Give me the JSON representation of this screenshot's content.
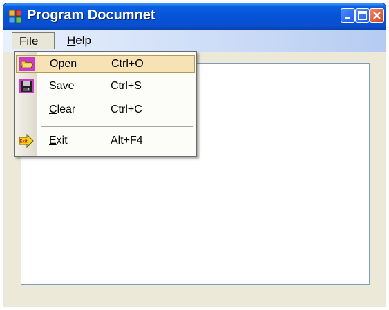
{
  "window": {
    "title": "Program Documnet"
  },
  "menubar": {
    "items": [
      {
        "label_ul": "F",
        "label_rest": "ile"
      },
      {
        "label_ul": "H",
        "label_rest": "elp"
      }
    ]
  },
  "file_menu": {
    "items": [
      {
        "ul": "O",
        "rest": "pen",
        "shortcut": "Ctrl+O",
        "icon": "open-folder-icon"
      },
      {
        "ul": "S",
        "rest": "ave",
        "shortcut": "Ctrl+S",
        "icon": "floppy-disk-icon"
      },
      {
        "ul": "C",
        "rest": "lear",
        "shortcut": "Ctrl+C",
        "icon": ""
      },
      {
        "ul": "E",
        "rest": "xit",
        "shortcut": "Alt+F4",
        "icon": "exit-arrow-icon"
      }
    ],
    "exit_icon_text": "Exit"
  },
  "colors": {
    "titlebar": "#0553d6",
    "highlight": "#f6e2b4",
    "highlight_border": "#b79a52"
  }
}
